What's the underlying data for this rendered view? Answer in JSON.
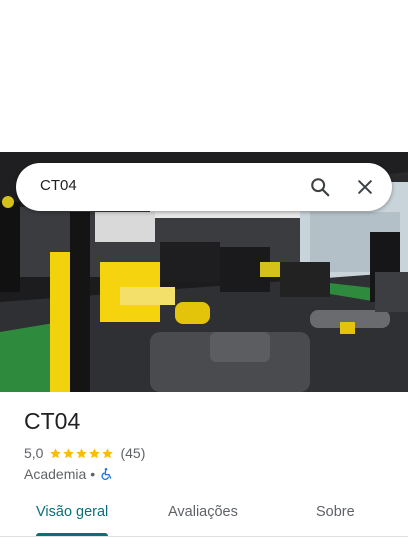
{
  "search": {
    "query": "CT04"
  },
  "place": {
    "name": "CT04",
    "rating": "5,0",
    "rating_stars": 5,
    "review_count": "(45)",
    "category": "Academia",
    "separator": "•"
  },
  "tabs": [
    {
      "label": "Visão geral",
      "active": true
    },
    {
      "label": "Avaliações",
      "active": false
    },
    {
      "label": "Sobre",
      "active": false
    }
  ],
  "colors": {
    "accent": "#0b6e79",
    "star": "#fbbc04",
    "accessibility_icon": "#1a73e8"
  },
  "icons": {
    "search": "search-icon",
    "close": "close-icon",
    "accessibility": "wheelchair-icon",
    "star": "star-icon"
  }
}
